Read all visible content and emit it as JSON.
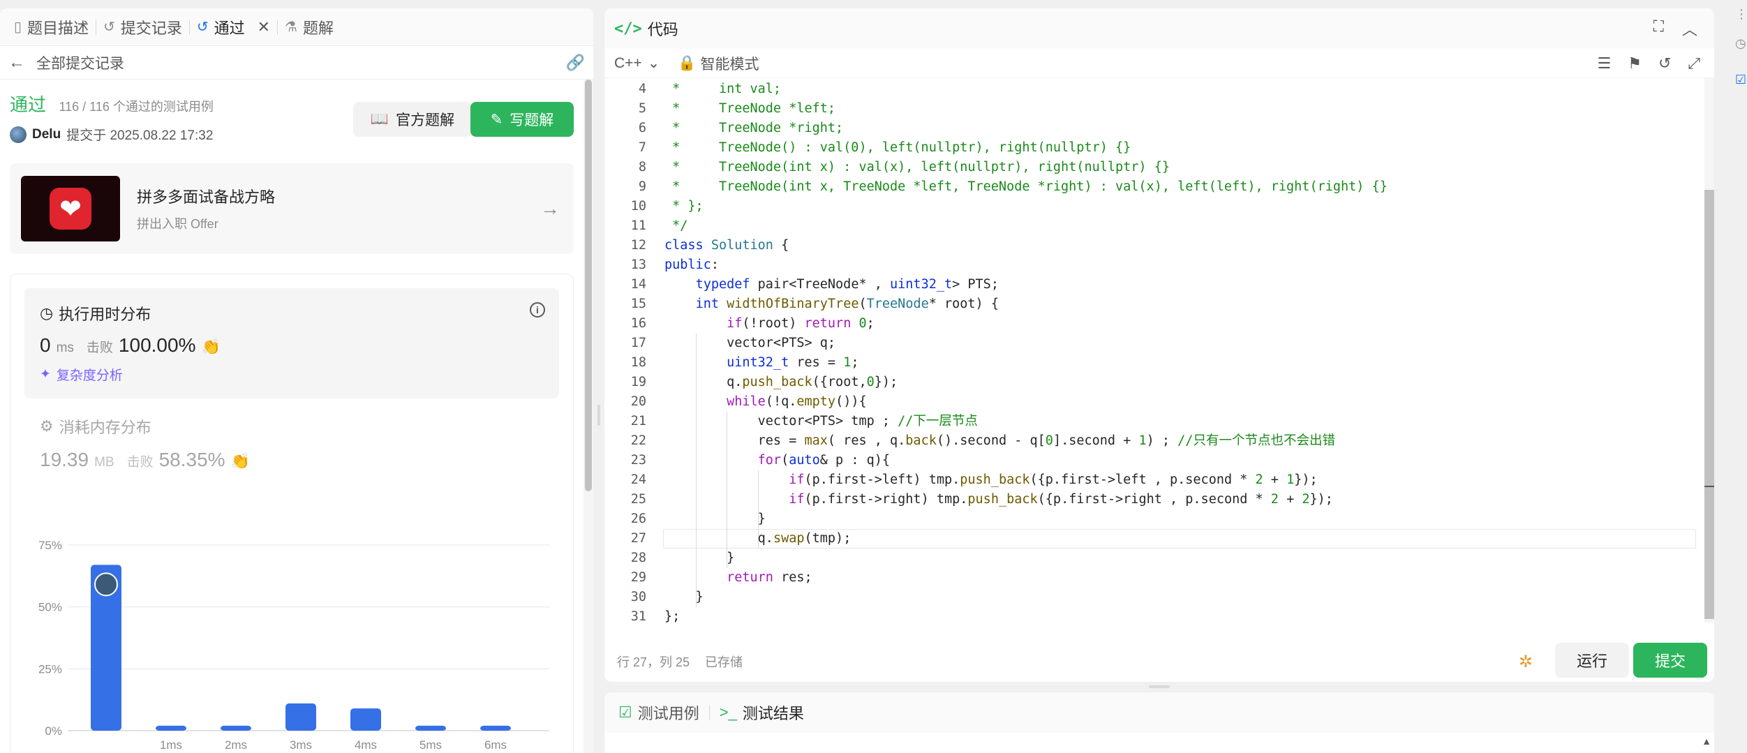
{
  "left": {
    "tabs": [
      {
        "label": "题目描述",
        "icon": "description-icon"
      },
      {
        "label": "提交记录",
        "icon": "history-icon"
      },
      {
        "label": "通过",
        "icon": "history-icon"
      },
      {
        "label": "题解",
        "icon": "flask-icon"
      }
    ],
    "back_label": "全部提交记录",
    "status": "通过",
    "cases": "116 / 116 个通过的测试用例",
    "submitter": "Delu",
    "submitted_at": "提交于 2025.08.22 17:32",
    "btn_official": "官方题解",
    "btn_write": "写题解",
    "promo_title": "拼多多面试备战方略",
    "promo_sub": "拼出入职 Offer",
    "runtime_title": "执行用时分布",
    "runtime_value": "0",
    "runtime_unit": "ms",
    "beat_label": "击败",
    "runtime_beat": "100.00%",
    "complexity": "复杂度分析",
    "memory_title": "消耗内存分布",
    "memory_value": "19.39",
    "memory_unit": "MB",
    "memory_beat": "58.35%"
  },
  "chart_data": {
    "type": "bar",
    "categories": [
      "",
      "1ms",
      "2ms",
      "3ms",
      "4ms",
      "5ms",
      "6ms"
    ],
    "values": [
      67,
      2,
      2,
      11,
      9,
      2,
      2
    ],
    "ylim": [
      0,
      75
    ],
    "yticks": [
      "0%",
      "25%",
      "50%",
      "75%"
    ],
    "highlight_index": 0,
    "bar_color": "#3570e6",
    "grid": true
  },
  "editor": {
    "title": "代码",
    "language": "C++",
    "mode": "智能模式",
    "status_pos": "行 27，列 25",
    "status_saved": "已存储",
    "run_label": "运行",
    "submit_label": "提交",
    "current_line": 27
  },
  "code_lines": [
    {
      "n": "4",
      "html": "<span class='c-com'> *     int val;</span>"
    },
    {
      "n": "5",
      "html": "<span class='c-com'> *     TreeNode *left;</span>"
    },
    {
      "n": "6",
      "html": "<span class='c-com'> *     TreeNode *right;</span>"
    },
    {
      "n": "7",
      "html": "<span class='c-com'> *     TreeNode() : val(0), left(nullptr), right(nullptr) {}</span>"
    },
    {
      "n": "8",
      "html": "<span class='c-com'> *     TreeNode(int x) : val(x), left(nullptr), right(nullptr) {}</span>"
    },
    {
      "n": "9",
      "html": "<span class='c-com'> *     TreeNode(int x, TreeNode *left, TreeNode *right) : val(x), left(left), right(right) {}</span>"
    },
    {
      "n": "10",
      "html": "<span class='c-com'> * };</span>"
    },
    {
      "n": "11",
      "html": "<span class='c-com'> */</span>"
    },
    {
      "n": "12",
      "html": "<span class='c-kw2'>class</span> <span class='c-type'>Solution</span> {"
    },
    {
      "n": "13",
      "html": "<span class='c-kw2'>public</span>:"
    },
    {
      "n": "14",
      "html": "    <span class='c-kw2'>typedef</span> pair&lt;TreeNode* , <span class='c-kw2'>uint32_t</span>&gt; PTS;"
    },
    {
      "n": "15",
      "html": "    <span class='c-kw2'>int</span> <span class='c-fn'>widthOfBinaryTree</span>(<span class='c-type'>TreeNode</span>* root) {"
    },
    {
      "n": "16",
      "html": "        <span class='c-kw'>if</span>(!root) <span class='c-kw'>return</span> <span class='c-num'>0</span>;"
    },
    {
      "n": "17",
      "html": "        vector&lt;PTS&gt; q;"
    },
    {
      "n": "18",
      "html": "        <span class='c-kw2'>uint32_t</span> res = <span class='c-num'>1</span>;"
    },
    {
      "n": "19",
      "html": "        q.<span class='c-fn'>push_back</span>({root,<span class='c-num'>0</span>});"
    },
    {
      "n": "20",
      "html": "        <span class='c-kw'>while</span>(!q.<span class='c-fn'>empty</span>()){"
    },
    {
      "n": "21",
      "html": "            vector&lt;PTS&gt; tmp ; <span class='c-com'>//下一层节点</span>"
    },
    {
      "n": "22",
      "html": "            res = <span class='c-fn'>max</span>( res , q.<span class='c-fn'>back</span>().second - q[<span class='c-num'>0</span>].second + <span class='c-num'>1</span>) ; <span class='c-com'>//只有一个节点也不会出错</span>"
    },
    {
      "n": "23",
      "html": "            <span class='c-kw'>for</span>(<span class='c-kw2'>auto</span>&amp; p : q){"
    },
    {
      "n": "24",
      "html": "                <span class='c-kw'>if</span>(p.first-&gt;left) tmp.<span class='c-fn'>push_back</span>({p.first-&gt;left , p.second * <span class='c-num'>2</span> + <span class='c-num'>1</span>});"
    },
    {
      "n": "25",
      "html": "                <span class='c-kw'>if</span>(p.first-&gt;right) tmp.<span class='c-fn'>push_back</span>({p.first-&gt;right , p.second * <span class='c-num'>2</span> + <span class='c-num'>2</span>});"
    },
    {
      "n": "26",
      "html": "            }"
    },
    {
      "n": "27",
      "html": "            q.<span class='c-fn'>swap</span>(tmp);"
    },
    {
      "n": "28",
      "html": "        }"
    },
    {
      "n": "29",
      "html": "        <span class='c-kw'>return</span> res;"
    },
    {
      "n": "30",
      "html": "    }"
    },
    {
      "n": "31",
      "html": "};"
    }
  ],
  "test": {
    "tab_cases": "测试用例",
    "tab_result": "测试结果"
  }
}
